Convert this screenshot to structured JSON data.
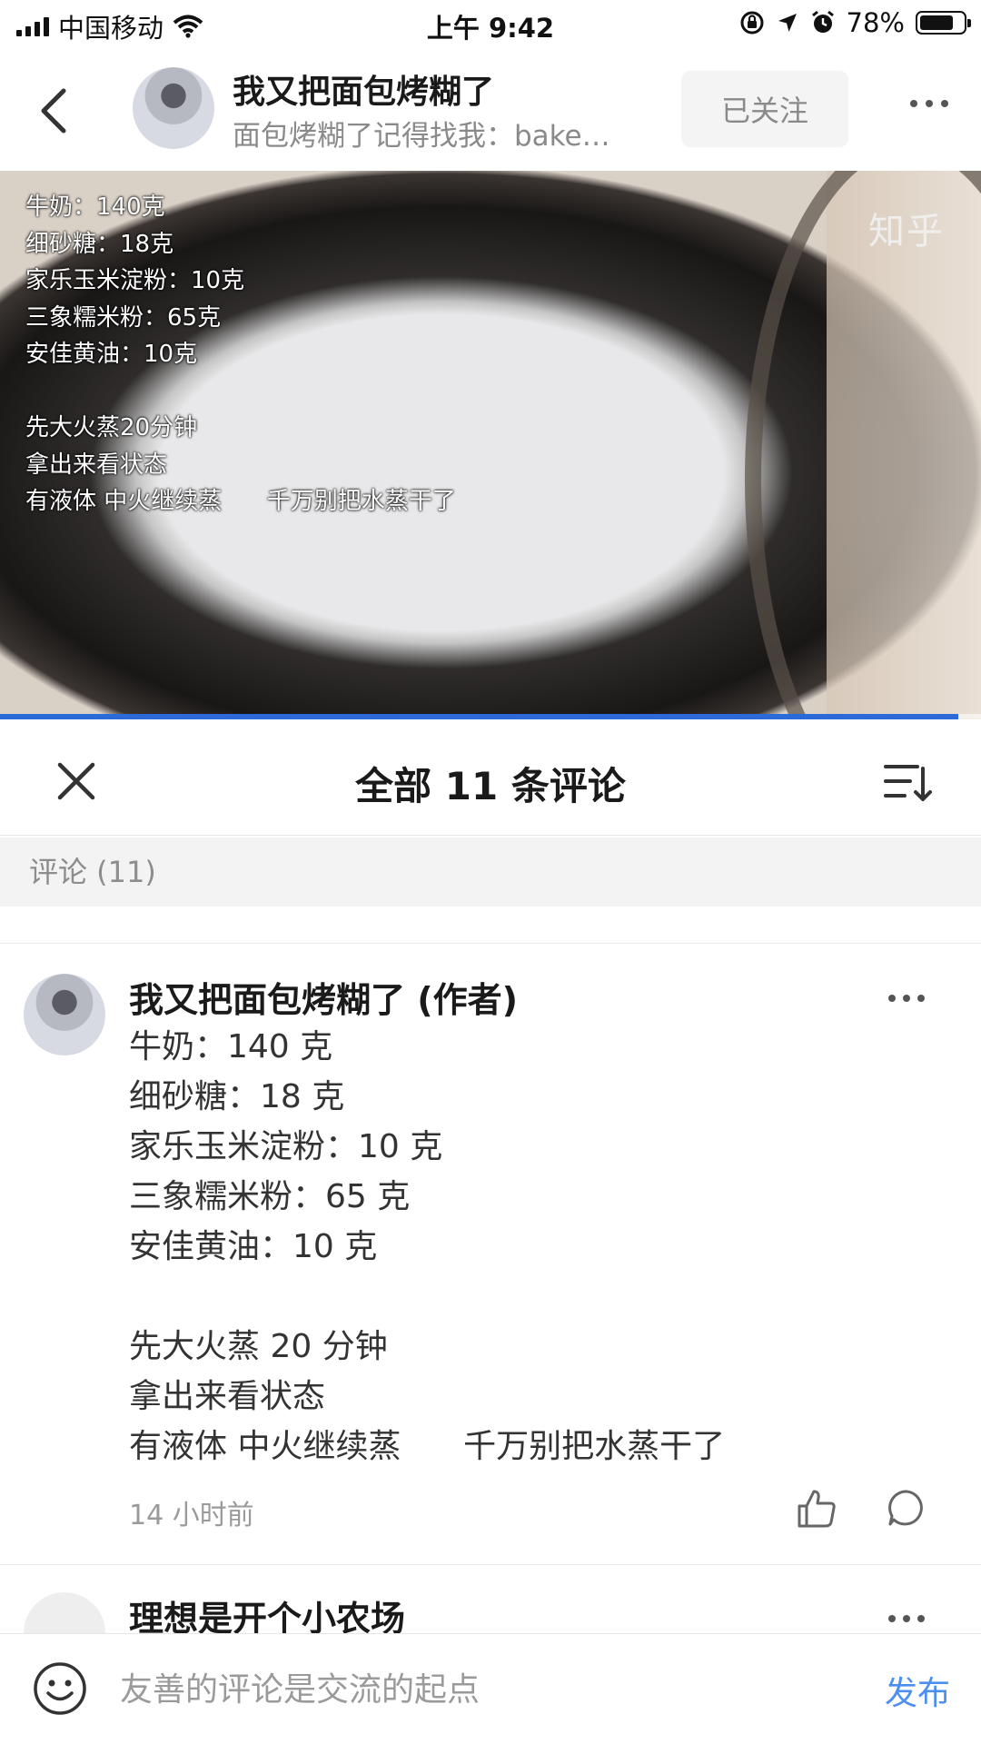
{
  "status_bar": {
    "carrier": "中国移动",
    "time": "上午 9:42",
    "battery_text": "78%",
    "battery_level": 0.78,
    "icons": [
      "signal-icon",
      "wifi-icon",
      "orientation-lock-icon",
      "location-icon",
      "alarm-icon",
      "battery-icon"
    ]
  },
  "header": {
    "title": "我又把面包烤糊了",
    "subtitle": "面包烤糊了记得找我：bake…",
    "follow_label": "已关注"
  },
  "video": {
    "overlay_text": "牛奶：140克\n细砂糖：18克\n家乐玉米淀粉：10克\n三象糯米粉：65克\n安佳黄油：10克\n\n先大火蒸20分钟\n拿出来看状态\n有液体 中火继续蒸      千万别把水蒸干了",
    "watermark": "知乎",
    "progress": 0.977,
    "progress_color": "#2d6ad9"
  },
  "comments_sheet": {
    "title": "全部 11 条评论",
    "section_label": "评论 (11)"
  },
  "comments": [
    {
      "author": "我又把面包烤糊了 (作者)",
      "body": "牛奶：140 克\n细砂糖：18 克\n家乐玉米淀粉：10 克\n三象糯米粉：65 克\n安佳黄油：10 克\n\n先大火蒸 20 分钟\n拿出来看状态\n有液体 中火继续蒸      千万别把水蒸干了",
      "time": "14 小时前"
    },
    {
      "author": "理想是开个小农场"
    }
  ],
  "input_bar": {
    "placeholder": "友善的评论是交流的起点",
    "publish_label": "发布",
    "accent_color": "#4d8ff0"
  }
}
